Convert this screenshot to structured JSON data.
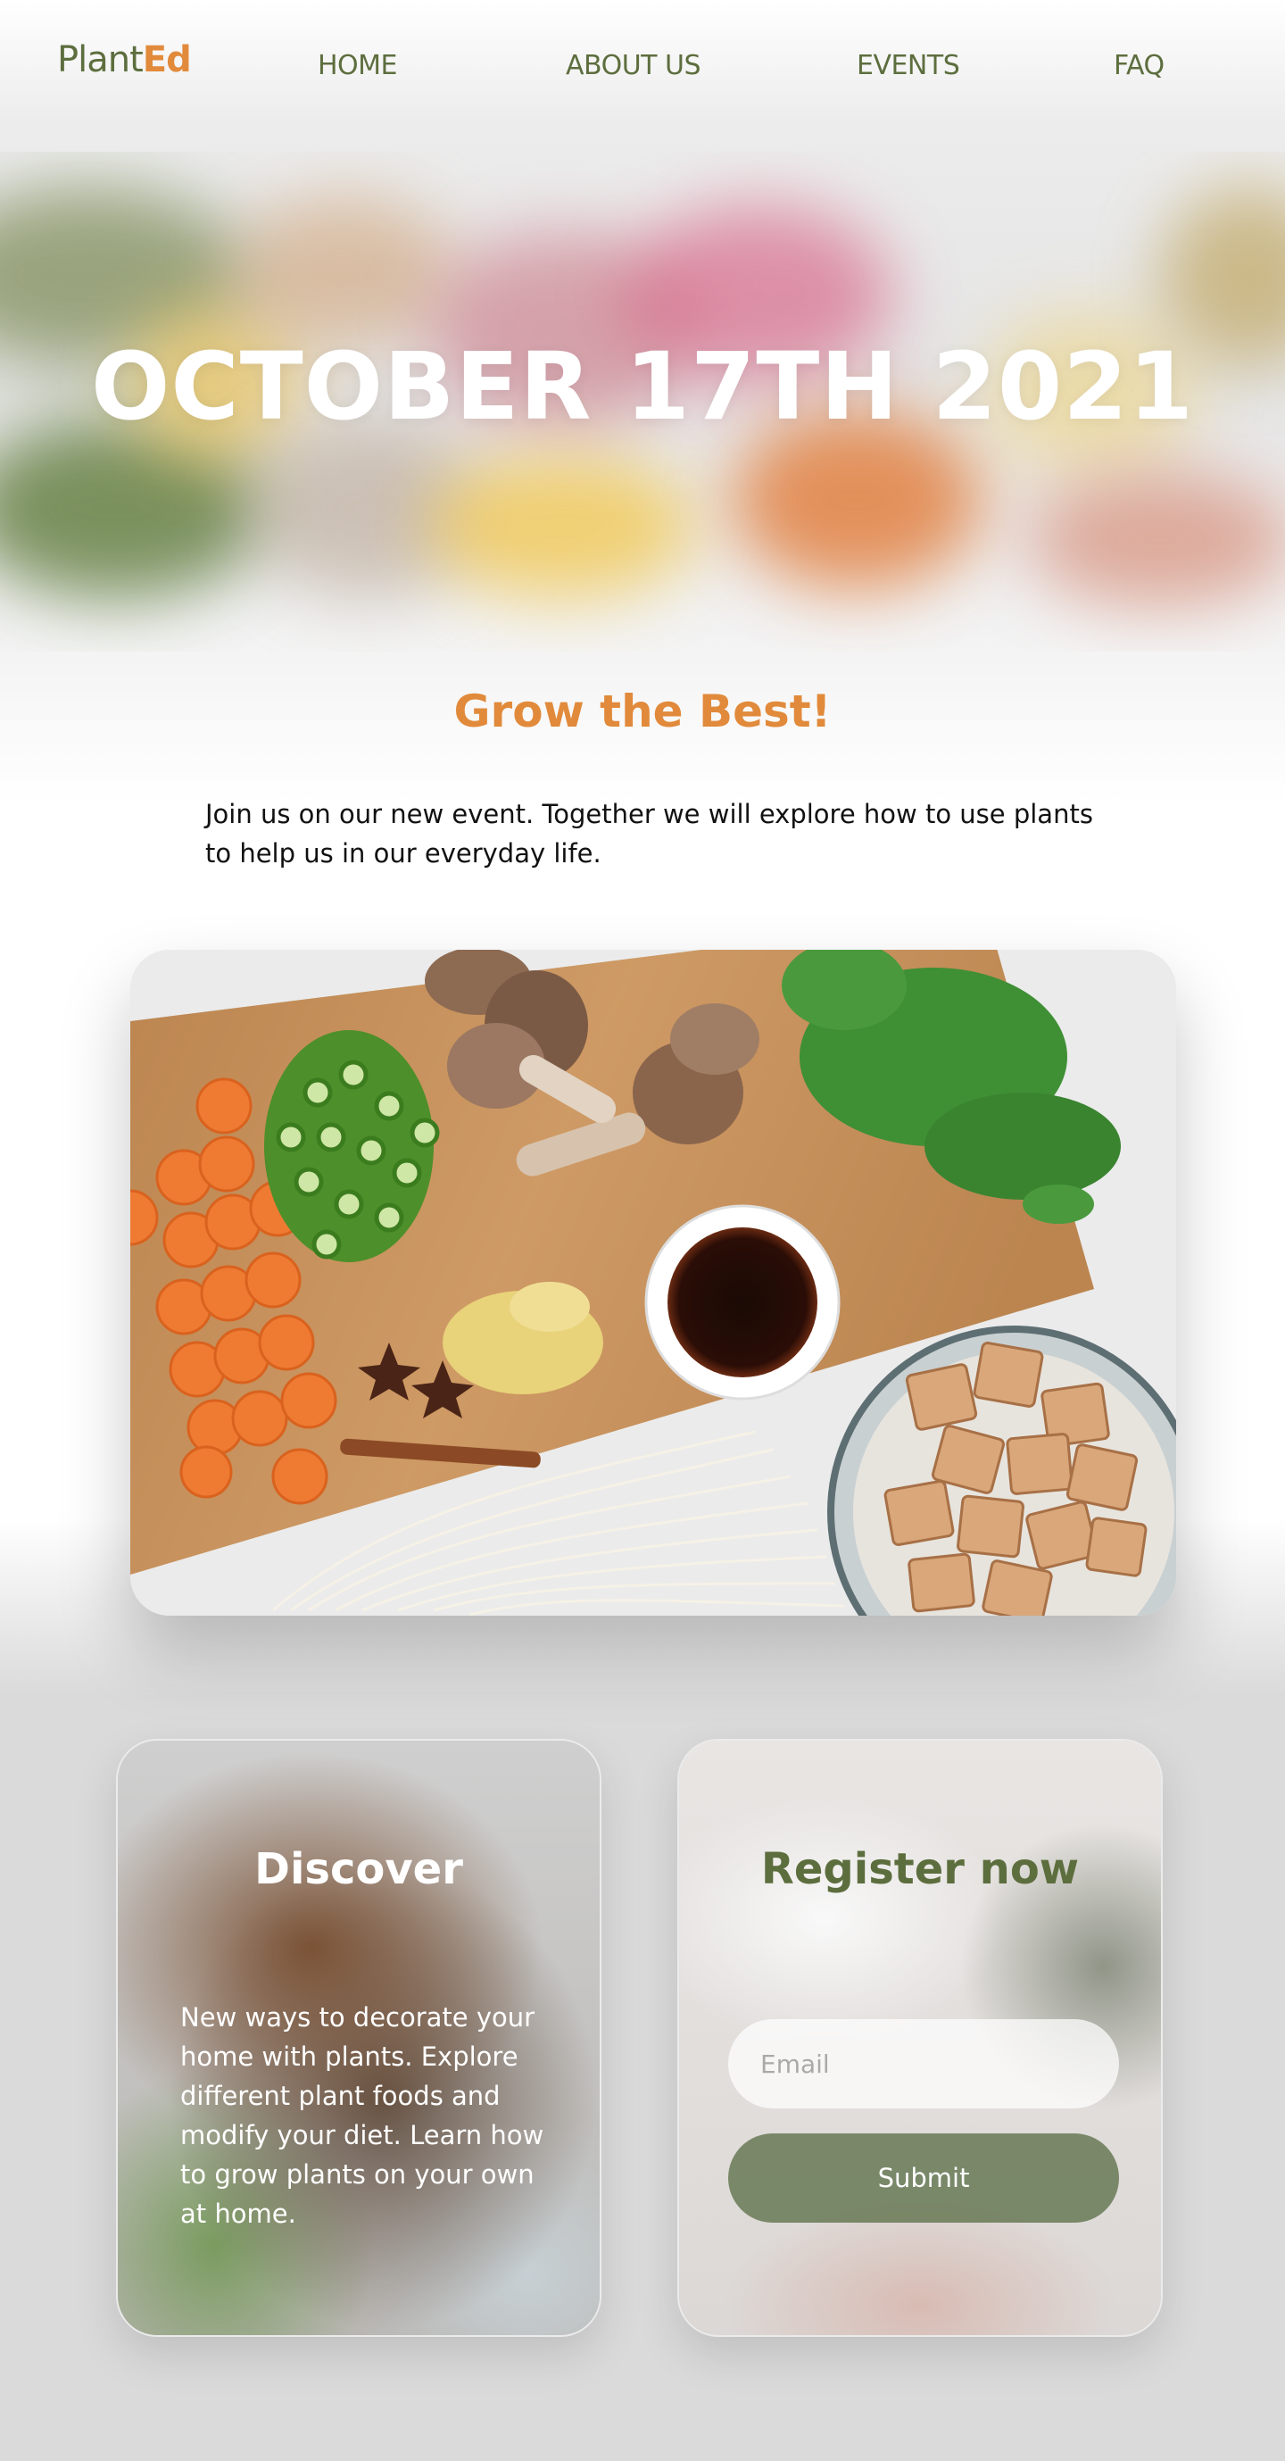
{
  "header": {
    "logo_part1": "Plant",
    "logo_part2": "Ed",
    "nav": [
      "HOME",
      "ABOUT US",
      "EVENTS",
      "FAQ"
    ]
  },
  "hero": {
    "title": "OCTOBER 17TH 2021",
    "subtitle": "Grow the Best!",
    "intro": "Join us on our new event. Together we will explore how to use plants to help us in our everyday life."
  },
  "discover": {
    "title": "Discover",
    "text": "New ways to decorate your home with plants. Explore different plant foods and modify your diet. Learn how to grow plants on your own at home."
  },
  "register": {
    "title": "Register now",
    "email_placeholder": "Email",
    "submit_label": "Submit"
  },
  "colors": {
    "brand_green": "#5d6e3e",
    "brand_orange": "#e18a3b",
    "button_green": "#63754f"
  }
}
